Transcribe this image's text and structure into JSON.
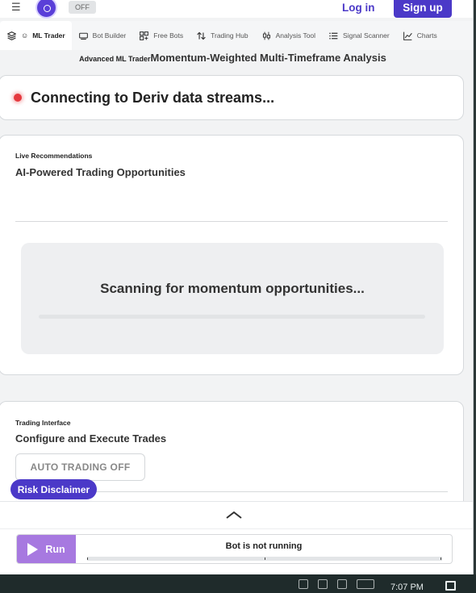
{
  "header": {
    "menu_icon": "hamburger-icon",
    "logo_icon": "deriv-logo-icon",
    "toggle_label": "OFF",
    "login_label": "Log in",
    "signup_label": "Sign up"
  },
  "tabs": [
    {
      "label": "ML Trader",
      "icon": "layers-icon",
      "active": true
    },
    {
      "label": "Bot Builder",
      "icon": "bot-builder-icon",
      "active": false
    },
    {
      "label": "Free Bots",
      "icon": "free-bots-icon",
      "active": false
    },
    {
      "label": "Trading Hub",
      "icon": "arrows-up-down-icon",
      "active": false
    },
    {
      "label": "Analysis Tool",
      "icon": "candlestick-icon",
      "active": false
    },
    {
      "label": "Signal Scanner",
      "icon": "list-icon",
      "active": false
    },
    {
      "label": "Charts",
      "icon": "line-chart-icon",
      "active": false
    }
  ],
  "subtitle": {
    "small": "Advanced ML Trader",
    "big": "Momentum-Weighted Multi-Timeframe Analysis"
  },
  "status": {
    "text": "Connecting to Deriv data streams...",
    "dot_color": "#e5393e"
  },
  "recommendations": {
    "label": "Live Recommendations",
    "title": "AI-Powered Trading Opportunities",
    "scanning_text": "Scanning for momentum opportunities..."
  },
  "trading": {
    "label": "Trading Interface",
    "title": "Configure and Execute Trades",
    "auto_button": "AUTO TRADING OFF"
  },
  "risk_disclaimer": "Risk Disclaimer",
  "bottom": {
    "run_label": "Run",
    "bot_status": "Bot is not running"
  },
  "taskbar": {
    "time": "7:07 PM"
  },
  "colors": {
    "accent": "#4b39c8",
    "run": "#a779e0",
    "status_red": "#e5393e"
  }
}
